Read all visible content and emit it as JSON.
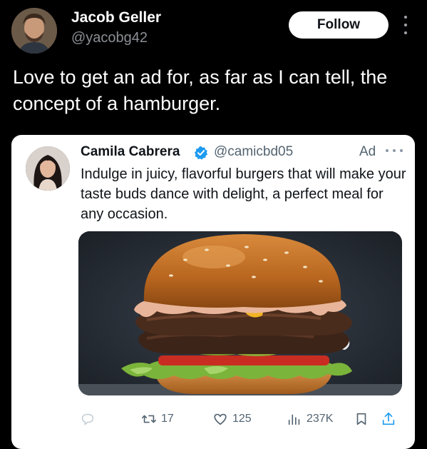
{
  "author": {
    "name": "Jacob Geller",
    "handle": "@yacobg42",
    "follow_label": "Follow"
  },
  "tweet": {
    "text": "Love to get an ad for, as far as I can tell, the concept of a hamburger."
  },
  "quoted_ad": {
    "name": "Camila Cabrera",
    "handle": "@camicbd05",
    "ad_label": "Ad",
    "text": "Indulge in juicy, flavorful burgers that will make your taste buds dance with delight, a perfect meal for any occasion.",
    "media_subject": "hamburger"
  },
  "actions": {
    "retweets": "17",
    "likes": "125",
    "views": "237K"
  },
  "colors": {
    "background": "#000000",
    "card": "#ffffff",
    "verified": "#1d9bf0",
    "muted": "#536471"
  }
}
